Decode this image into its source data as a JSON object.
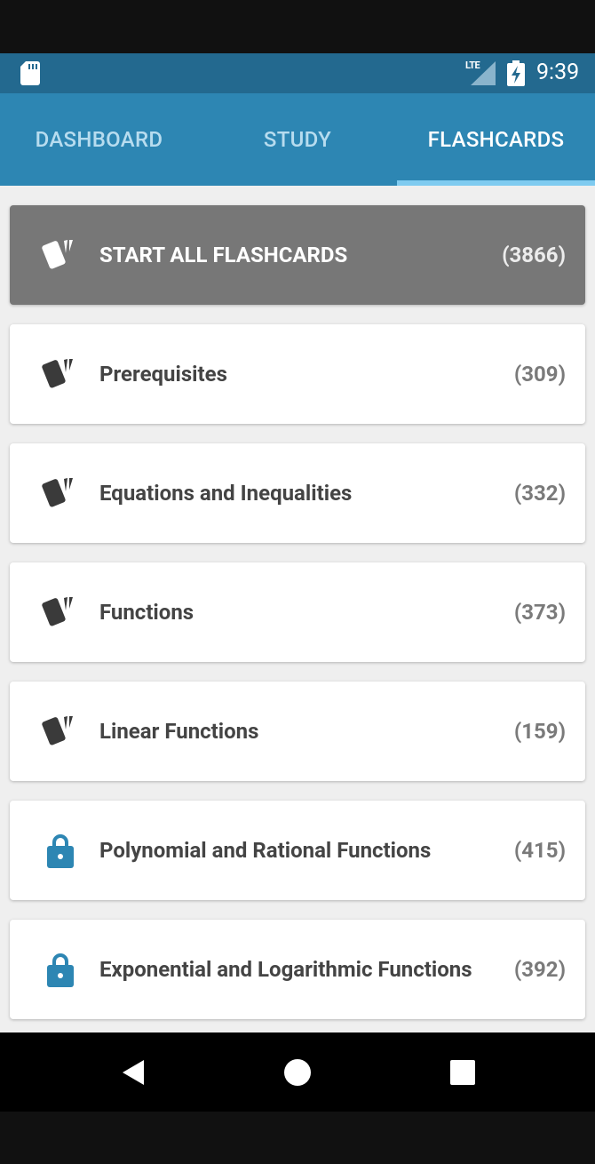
{
  "status_bar": {
    "network": "LTE",
    "time": "9:39",
    "icons": [
      "sd-card-icon",
      "signal-icon",
      "battery-charging-icon"
    ]
  },
  "tabs": [
    {
      "label": "DASHBOARD",
      "active": false
    },
    {
      "label": "STUDY",
      "active": false
    },
    {
      "label": "FLASHCARDS",
      "active": true
    }
  ],
  "start_all": {
    "label": "START ALL FLASHCARDS",
    "count": "(3866)",
    "icon": "flashcards-icon"
  },
  "decks": [
    {
      "label": "Prerequisites",
      "count": "(309)",
      "icon": "flashcards-icon",
      "locked": false
    },
    {
      "label": "Equations and Inequalities",
      "count": "(332)",
      "icon": "flashcards-icon",
      "locked": false
    },
    {
      "label": "Functions",
      "count": "(373)",
      "icon": "flashcards-icon",
      "locked": false
    },
    {
      "label": "Linear Functions",
      "count": "(159)",
      "icon": "flashcards-icon",
      "locked": false
    },
    {
      "label": "Polynomial and Rational Functions",
      "count": "(415)",
      "icon": "lock-icon",
      "locked": true
    },
    {
      "label": "Exponential and Logarithmic Functions",
      "count": "(392)",
      "icon": "lock-icon",
      "locked": true
    }
  ],
  "nav": {
    "icons": [
      "back-icon",
      "home-icon",
      "recents-icon"
    ]
  },
  "colors": {
    "status_bar": "#23698f",
    "tab_bar": "#2d86b3",
    "tab_indicator": "#7fcbf0",
    "start_all_card": "#777777",
    "lock_icon": "#2d86b3",
    "card_text": "#444444"
  }
}
